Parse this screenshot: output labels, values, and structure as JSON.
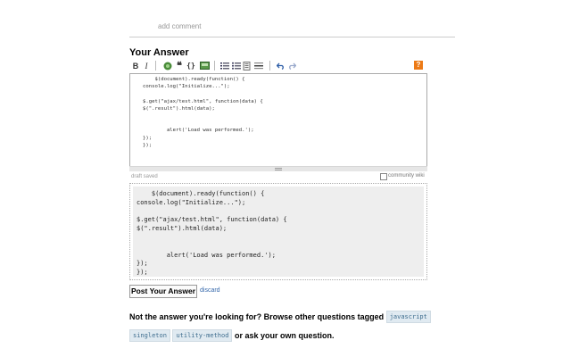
{
  "comment": {
    "add_label": "add comment"
  },
  "answer": {
    "heading": "Your Answer"
  },
  "toolbar": {
    "bold": "B",
    "italic": "I",
    "blockquote": "❝",
    "code": "{}",
    "help": "?"
  },
  "editor": {
    "code": "    $(document).ready(function() {\nconsole.log(\"Initialize...\");\n\n$.get(\"ajax/test.html\", function(data) {\n$(\".result\").html(data);\n\n\n        alert('Load was performed.');\n});\n});"
  },
  "status": {
    "draft_saved": "draft saved",
    "community_wiki": "community wiki"
  },
  "preview": {
    "code": "    $(document).ready(function() {\nconsole.log(\"Initialize...\");\n\n$.get(\"ajax/test.html\", function(data) {\n$(\".result\").html(data);\n\n\n        alert('Load was performed.');\n});\n});"
  },
  "actions": {
    "post_label": "Post Your Answer",
    "discard_label": "discard"
  },
  "footer": {
    "text_before": "Not the answer you're looking for? Browse other questions tagged",
    "tags": [
      "javascript",
      "singleton",
      "utility-method"
    ],
    "text_or": "or",
    "ask_link": "ask your own question",
    "period": "."
  }
}
